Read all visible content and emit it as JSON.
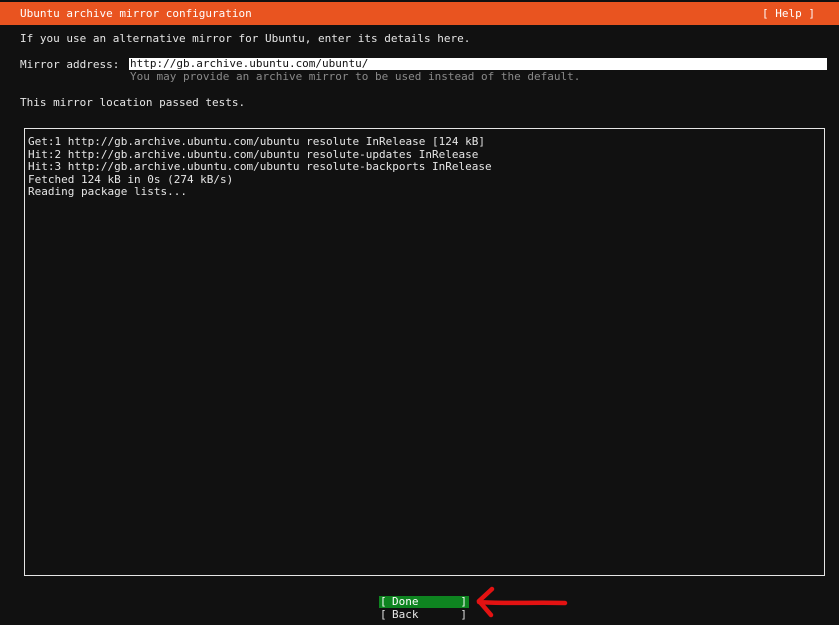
{
  "header": {
    "title": "Ubuntu archive mirror configuration",
    "help_label": "[ Help ]"
  },
  "intro_text": "If you use an alternative mirror for Ubuntu, enter its details here.",
  "mirror": {
    "label": "Mirror address:",
    "value": "http://gb.archive.ubuntu.com/ubuntu/",
    "help_text": "You may provide an archive mirror to be used instead of the default."
  },
  "status_text": "This mirror location passed tests.",
  "log_lines": [
    "Get:1 http://gb.archive.ubuntu.com/ubuntu resolute InRelease [124 kB]",
    "Hit:2 http://gb.archive.ubuntu.com/ubuntu resolute-updates InRelease",
    "Hit:3 http://gb.archive.ubuntu.com/ubuntu resolute-backports InRelease",
    "Fetched 124 kB in 0s (274 kB/s)",
    "Reading package lists..."
  ],
  "buttons": {
    "open_bracket": "[",
    "close_bracket": "]",
    "done_label": "Done",
    "back_label": "Back"
  },
  "colors": {
    "header_background": "#e95420",
    "done_background": "#0e8420",
    "annotation_arrow": "#e31212"
  },
  "icons": {
    "annotation": "red-arrow-pointing-left"
  }
}
